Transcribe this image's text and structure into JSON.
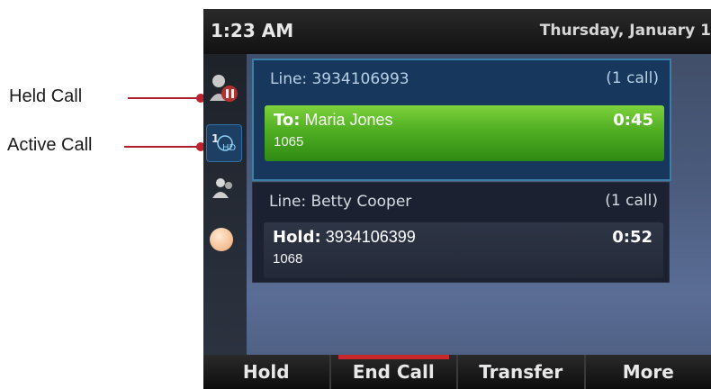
{
  "annotations": {
    "held_call": "Held Call",
    "active_call": "Active Call"
  },
  "status": {
    "time": "1:23 AM",
    "date": "Thursday, January 1"
  },
  "calls": [
    {
      "line_label": "Line:",
      "line_value": "3934106993",
      "count": "(1 call)",
      "state_label": "To:",
      "party": "Maria Jones",
      "extension": "1065",
      "timer": "0:45"
    },
    {
      "line_label": "Line:",
      "line_value": "Betty Cooper",
      "count": "(1 call)",
      "state_label": "Hold:",
      "party": "3934106399",
      "extension": "1068",
      "timer": "0:52"
    }
  ],
  "softkeys": [
    "Hold",
    "End Call",
    "Transfer",
    "More"
  ],
  "colors": {
    "active_bar": "#4fae22",
    "selected_softkey": "#c8282c",
    "callout": "#c0202c"
  },
  "icons": {
    "held_line": "held-call-icon",
    "active_line": "active-call-icon",
    "contact": "contact-icon",
    "presence": "presence-dot-icon"
  }
}
